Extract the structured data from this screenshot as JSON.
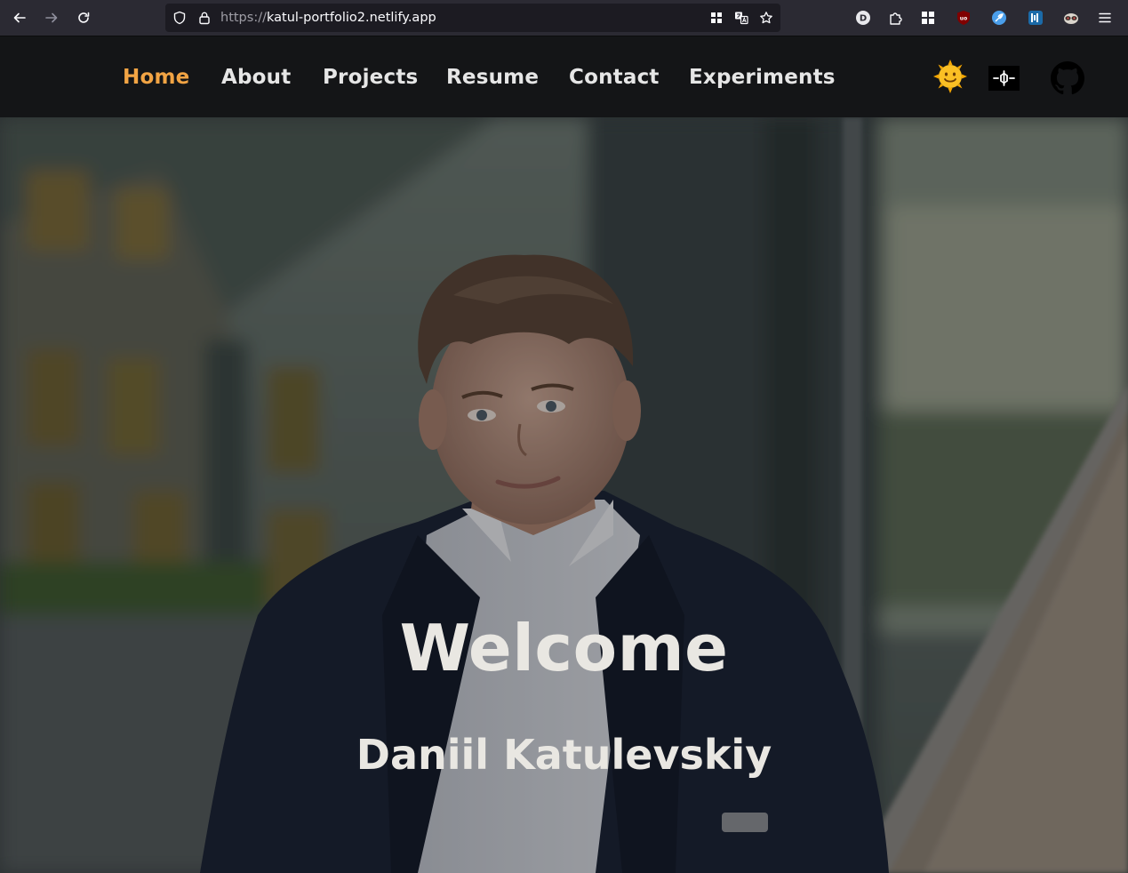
{
  "browser": {
    "url_protocol": "https://",
    "url_host": "katul-portfolio2.netlify.app",
    "icons": {
      "back": "arrow-left-icon",
      "forward": "arrow-right-icon",
      "reload": "reload-icon",
      "shield": "shield-icon",
      "lock": "lock-icon",
      "grid": "grid-icon",
      "translate": "translate-icon",
      "bookmark": "star-icon",
      "menu": "hamburger-icon"
    },
    "extensions": [
      {
        "name": "d-extension",
        "letter": "D"
      },
      {
        "name": "extensions-puzzle"
      },
      {
        "name": "apps-grid"
      },
      {
        "name": "ublock-origin",
        "letter": "uo"
      },
      {
        "name": "feather-extension"
      },
      {
        "name": "blue-extension"
      },
      {
        "name": "privacy-badger"
      }
    ]
  },
  "header": {
    "nav": [
      {
        "label": "Home",
        "active": true
      },
      {
        "label": "About",
        "active": false
      },
      {
        "label": "Projects",
        "active": false
      },
      {
        "label": "Resume",
        "active": false
      },
      {
        "label": "Contact",
        "active": false
      },
      {
        "label": "Experiments",
        "active": false
      }
    ],
    "icons": {
      "theme": "sun-face-icon",
      "codepen": "codepen-icon",
      "github": "github-icon"
    },
    "colors": {
      "background": "#141517",
      "active": "#f2a444",
      "text": "#e6e6e6"
    }
  },
  "hero": {
    "title": "Welcome",
    "subtitle": "Daniil Katulevskiy",
    "text_color": "#e9e7e2"
  }
}
